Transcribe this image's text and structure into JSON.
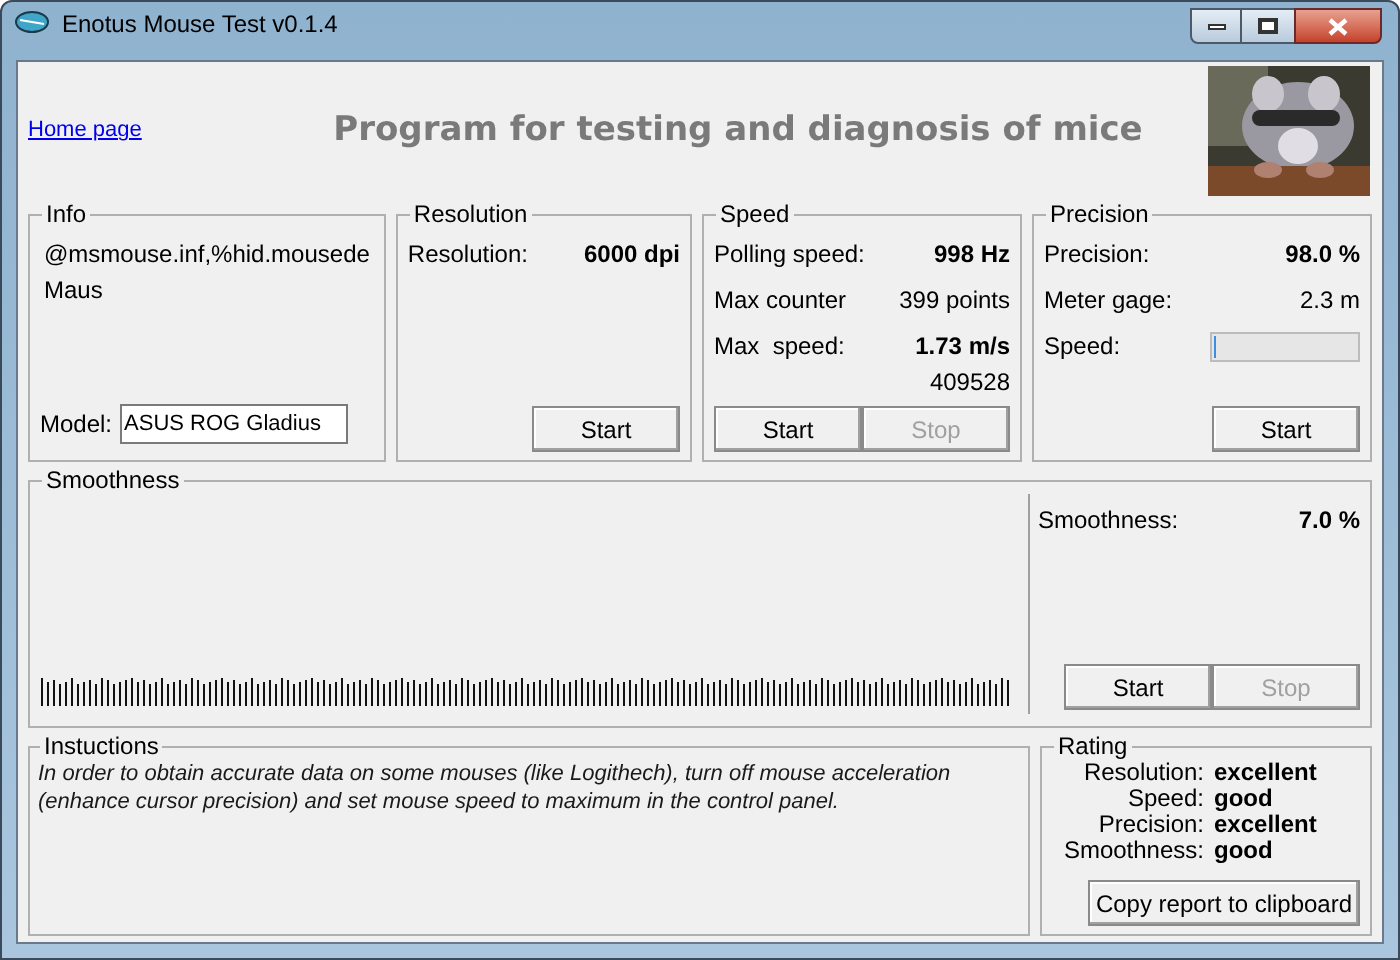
{
  "window": {
    "title": "Enotus Mouse Test v0.1.4"
  },
  "header": {
    "link": "Home page",
    "heading": "Program for testing and diagnosis of mice"
  },
  "info": {
    "title": "Info",
    "device_lines": [
      "@msmouse.inf,%hid.mousede",
      "Maus"
    ],
    "model_label": "Model:",
    "model_value": "ASUS ROG Gladius"
  },
  "resolution": {
    "title": "Resolution",
    "rows": [
      {
        "kind": "value",
        "label": "Resolution:",
        "value": "6000 dpi",
        "emphasis": true
      }
    ],
    "buttons": [
      {
        "label": "Start",
        "disabled": false
      }
    ]
  },
  "speed": {
    "title": "Speed",
    "rows": [
      {
        "kind": "value",
        "label": "Polling speed:",
        "value": "998 Hz",
        "emphasis": true
      },
      {
        "kind": "value",
        "label": "Max counter",
        "value": "399 points",
        "emphasis": false
      },
      {
        "kind": "value",
        "label": "Max  speed:",
        "value": "1.73 m/s",
        "emphasis": true,
        "note": "409528"
      }
    ],
    "buttons": [
      {
        "label": "Start",
        "disabled": false
      },
      {
        "label": "Stop",
        "disabled": true
      }
    ]
  },
  "precision": {
    "title": "Precision",
    "rows": [
      {
        "kind": "value",
        "label": "Precision:",
        "value": "98.0 %",
        "emphasis": true
      },
      {
        "kind": "value",
        "label": "Meter gage:",
        "value": "2.3 m",
        "emphasis": false
      },
      {
        "kind": "meter",
        "label": "Speed:",
        "level": 0.02
      }
    ],
    "buttons": [
      {
        "label": "Start",
        "disabled": false
      }
    ]
  },
  "smoothness": {
    "title": "Smoothness",
    "rows": [
      {
        "kind": "value",
        "label": "Smoothness:",
        "value": "7.0 %",
        "emphasis": true
      }
    ],
    "buttons": [
      {
        "label": "Start",
        "disabled": false
      },
      {
        "label": "Stop",
        "disabled": true
      }
    ]
  },
  "instructions": {
    "title": "Instuctions",
    "text": "In order to obtain accurate data on some mouses (like Logithech), turn off mouse acceleration (enhance cursor precision) and set mouse speed to maximum in the control panel."
  },
  "rating": {
    "title": "Rating",
    "rows": [
      {
        "label": "Resolution:",
        "value": "excellent"
      },
      {
        "label": "Speed:",
        "value": "good"
      },
      {
        "label": "Precision:",
        "value": "excellent"
      },
      {
        "label": "Smoothness:",
        "value": "good"
      }
    ],
    "button": {
      "label": "Copy report to clipboard",
      "disabled": false
    }
  }
}
